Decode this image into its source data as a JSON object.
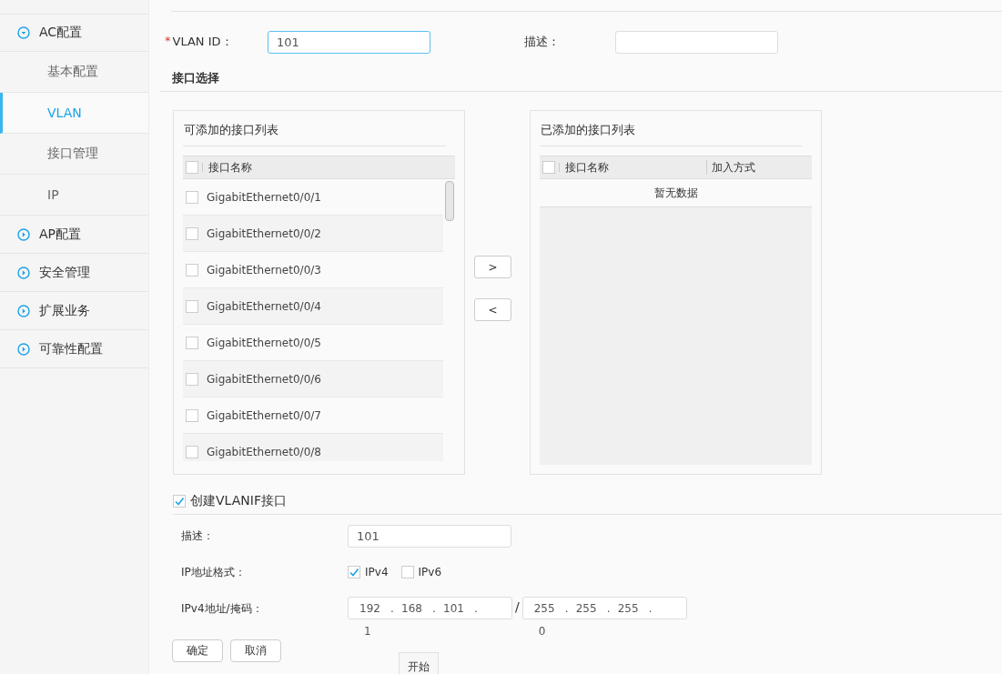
{
  "sidebar": {
    "items": [
      {
        "label": "AC配置",
        "kind": "group",
        "expanded": true,
        "children": [
          {
            "label": "基本配置",
            "selected": false
          },
          {
            "label": "VLAN",
            "selected": true
          },
          {
            "label": "接口管理",
            "selected": false
          },
          {
            "label": "IP",
            "selected": false
          }
        ]
      },
      {
        "label": "AP配置",
        "kind": "group",
        "expanded": false
      },
      {
        "label": "安全管理",
        "kind": "group",
        "expanded": false
      },
      {
        "label": "扩展业务",
        "kind": "group",
        "expanded": false
      },
      {
        "label": "可靠性配置",
        "kind": "group",
        "expanded": false
      }
    ]
  },
  "vlan_id": {
    "label": "VLAN ID：",
    "required_mark": "*",
    "value": "101"
  },
  "description": {
    "label": "描述："
  },
  "interface_section": {
    "title": "接口选择",
    "available": {
      "title": "可添加的接口列表",
      "columns": [
        "接口名称"
      ],
      "header_checked": false,
      "rows": [
        {
          "name": "GigabitEthernet0/0/1",
          "checked": false
        },
        {
          "name": "GigabitEthernet0/0/2",
          "checked": false
        },
        {
          "name": "GigabitEthernet0/0/3",
          "checked": false
        },
        {
          "name": "GigabitEthernet0/0/4",
          "checked": false
        },
        {
          "name": "GigabitEthernet0/0/5",
          "checked": false
        },
        {
          "name": "GigabitEthernet0/0/6",
          "checked": false
        },
        {
          "name": "GigabitEthernet0/0/7",
          "checked": false
        },
        {
          "name": "GigabitEthernet0/0/8",
          "checked": false
        }
      ]
    },
    "move_buttons": [
      ">",
      "<"
    ],
    "added": {
      "title": "已添加的接口列表",
      "columns": [
        "接口名称",
        "加入方式"
      ],
      "header_checked": false,
      "empty_text": "暂无数据"
    }
  },
  "vlanif": {
    "label": "创建VLANIF接口",
    "checked": true,
    "description": {
      "label": "描述：",
      "value": "101"
    },
    "ip_format": {
      "label": "IP地址格式：",
      "options": [
        {
          "label": "IPv4",
          "checked": true
        },
        {
          "label": "IPv6",
          "checked": false
        }
      ]
    },
    "address": {
      "label": "IPv4地址/掩码：",
      "ip": [
        "192",
        "168",
        "101",
        "1"
      ],
      "ip_dots": [
        ".",
        ".",
        "."
      ],
      "separator": "/",
      "mask": [
        "255",
        "255",
        "255",
        "0"
      ],
      "mask_dots": [
        ".",
        ".",
        "."
      ]
    }
  },
  "buttons": [
    "确定",
    "取消"
  ],
  "tooltip": "开始"
}
